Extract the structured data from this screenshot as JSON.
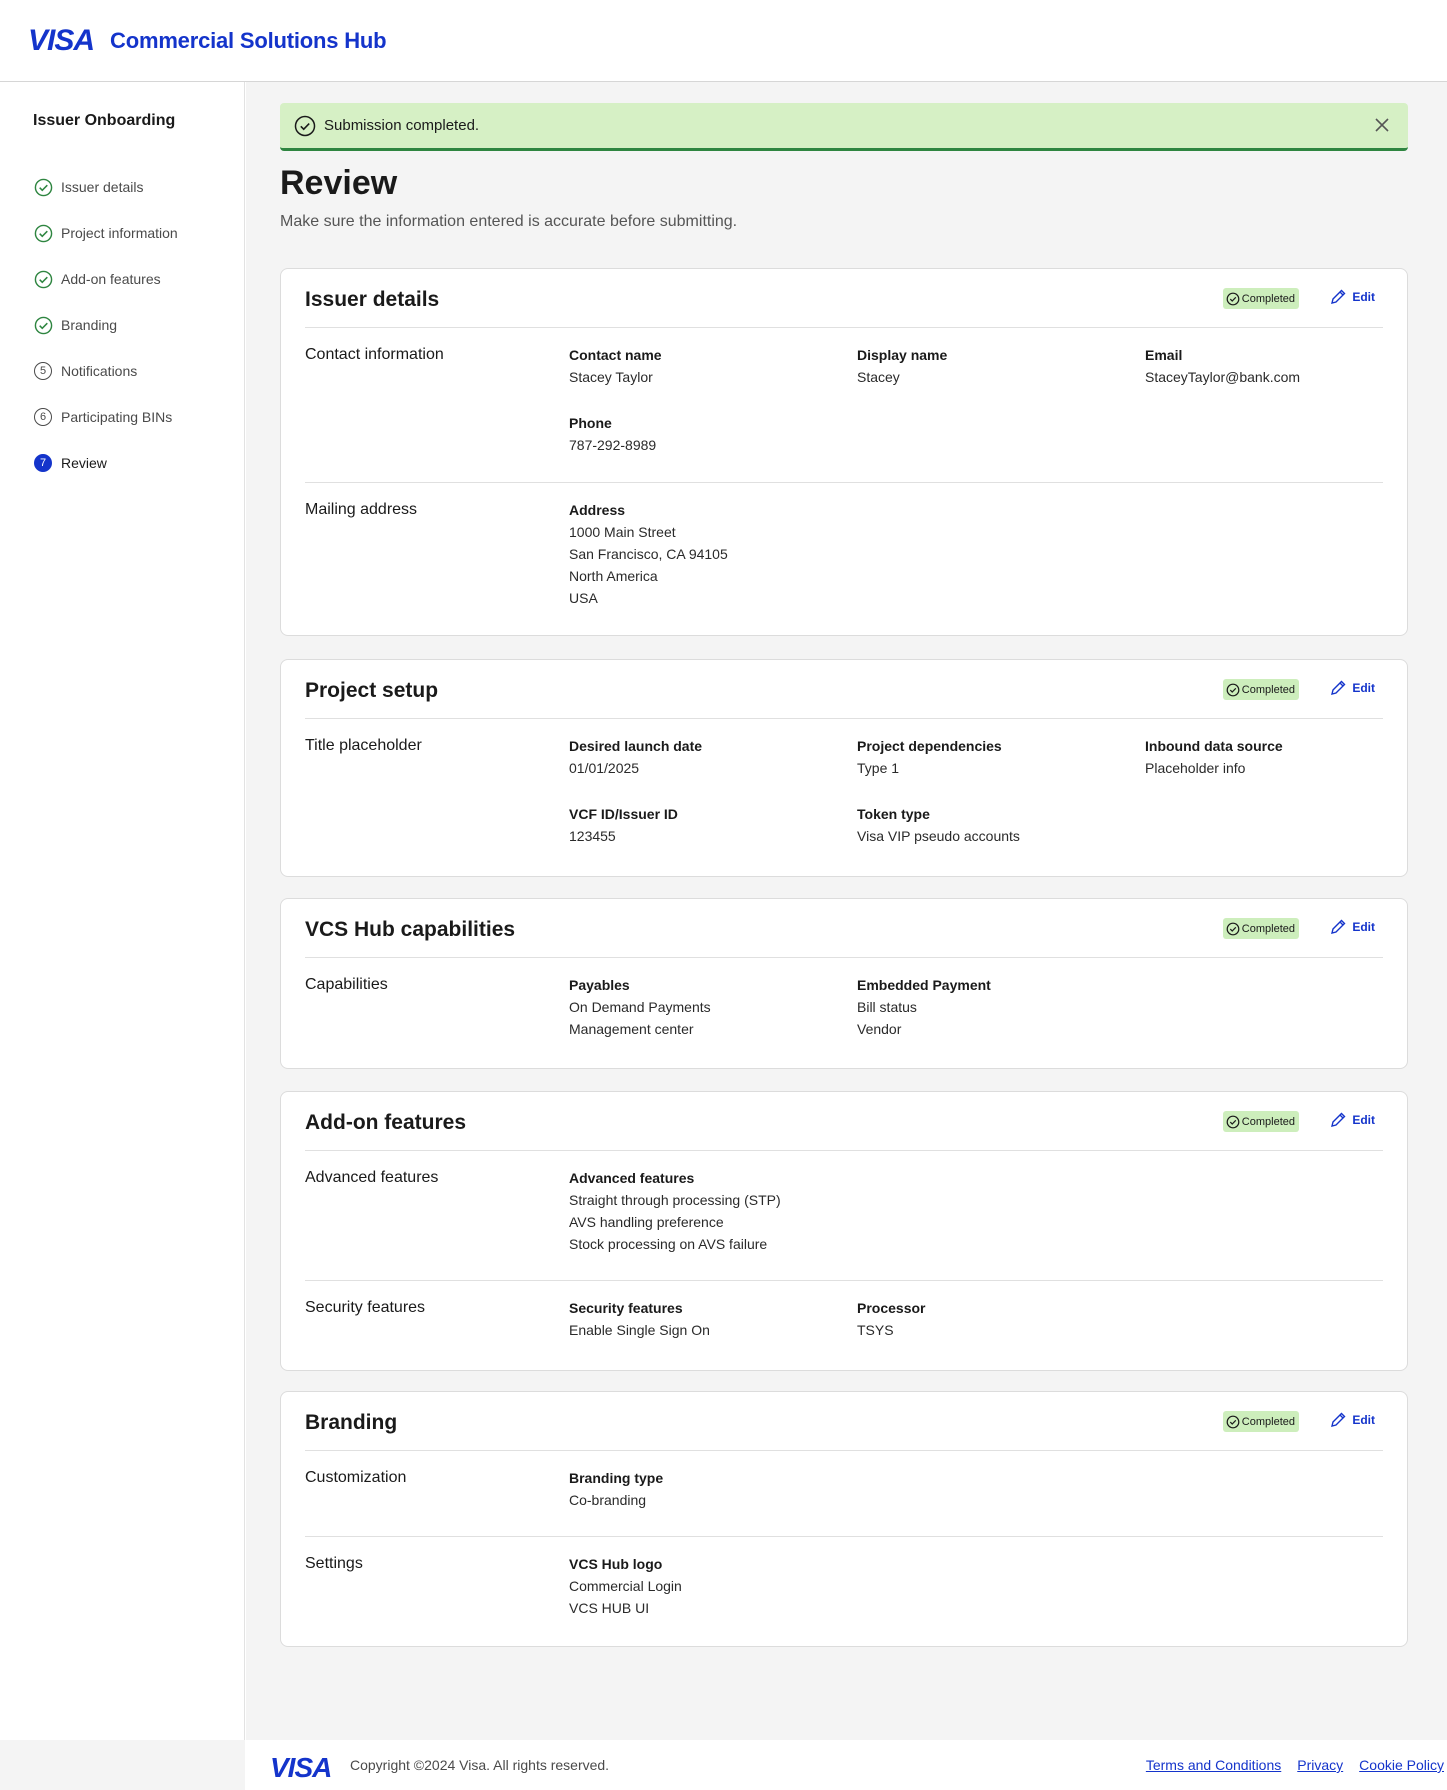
{
  "header": {
    "logo": "VISA",
    "app_title": "Commercial Solutions Hub"
  },
  "sidebar": {
    "title": "Issuer Onboarding",
    "steps": [
      {
        "label": "Issuer details",
        "state": "done"
      },
      {
        "label": "Project information",
        "state": "done"
      },
      {
        "label": "Add-on features",
        "state": "done"
      },
      {
        "label": "Branding",
        "state": "done"
      },
      {
        "label": "Notifications",
        "state": "pending",
        "num": "5"
      },
      {
        "label": "Participating BINs",
        "state": "pending",
        "num": "6"
      },
      {
        "label": "Review",
        "state": "active",
        "num": "7"
      }
    ]
  },
  "banner": {
    "text": "Submission completed."
  },
  "page": {
    "title": "Review",
    "subtitle": "Make sure the information entered is accurate before submitting."
  },
  "labels": {
    "completed": "Completed",
    "edit": "Edit"
  },
  "cards": {
    "issuer": {
      "title": "Issuer details",
      "contact": {
        "label": "Contact information",
        "contact_name": {
          "label": "Contact name",
          "value": "Stacey Taylor"
        },
        "display_name": {
          "label": "Display name",
          "value": "Stacey"
        },
        "email": {
          "label": "Email",
          "value": "StaceyTaylor@bank.com"
        },
        "phone": {
          "label": "Phone",
          "value": "787-292-8989"
        }
      },
      "mailing": {
        "label": "Mailing address",
        "address": {
          "label": "Address",
          "lines": [
            "1000 Main Street",
            "San Francisco, CA 94105",
            "North America",
            "USA"
          ]
        }
      }
    },
    "project": {
      "title": "Project setup",
      "section": {
        "label": "Title placeholder",
        "launch": {
          "label": "Desired launch date",
          "value": "01/01/2025"
        },
        "deps": {
          "label": "Project dependencies",
          "value": "Type 1"
        },
        "inbound": {
          "label": "Inbound data source",
          "value": "Placeholder info"
        },
        "vcf": {
          "label": "VCF ID/Issuer ID",
          "value": "123455"
        },
        "token": {
          "label": "Token type",
          "value": "Visa VIP pseudo accounts"
        }
      }
    },
    "capabilities": {
      "title": "VCS Hub capabilities",
      "section": {
        "label": "Capabilities",
        "payables": {
          "label": "Payables",
          "lines": [
            "On Demand Payments",
            "Management center"
          ]
        },
        "embedded": {
          "label": "Embedded Payment",
          "lines": [
            "Bill status",
            "Vendor"
          ]
        }
      }
    },
    "addon": {
      "title": "Add-on features",
      "advanced": {
        "label": "Advanced features",
        "field": {
          "label": "Advanced features",
          "lines": [
            "Straight through processing (STP)",
            "AVS handling preference",
            "Stock processing on AVS failure"
          ]
        }
      },
      "security": {
        "label": "Security features",
        "field": {
          "label": "Security features",
          "value": "Enable Single Sign On"
        },
        "processor": {
          "label": "Processor",
          "value": "TSYS"
        }
      }
    },
    "branding": {
      "title": "Branding",
      "custom": {
        "label": "Customization",
        "field": {
          "label": "Branding type",
          "value": "Co-branding"
        }
      },
      "settings": {
        "label": "Settings",
        "field": {
          "label": "VCS Hub logo",
          "lines": [
            "Commercial Login",
            "VCS HUB UI"
          ]
        }
      }
    }
  },
  "footer": {
    "logo": "VISA",
    "copyright": "Copyright ©2024 Visa. All rights reserved.",
    "links": [
      "Terms and Conditions",
      "Privacy",
      "Cookie Policy"
    ]
  },
  "colors": {
    "brand": "#1434cb",
    "success_bg": "#d6f0c5",
    "success_border": "#2e8540",
    "badge_bg": "#cdeebc",
    "page_bg": "#f4f4f4"
  }
}
